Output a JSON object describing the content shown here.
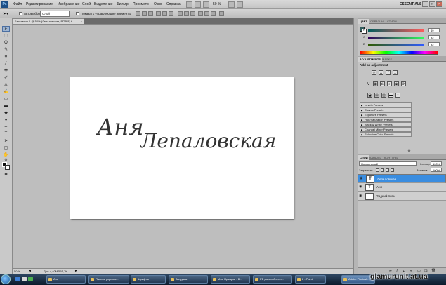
{
  "menubar": {
    "app_logo": "Ps",
    "items": [
      "Файл",
      "Редактирование",
      "Изображение",
      "Слой",
      "Выделение",
      "Фильтр",
      "Просмотр",
      "Окно",
      "Справка"
    ],
    "zoom": "50 %",
    "workspace": "ESSENTIALS ▾"
  },
  "options": {
    "autoselect_label": "Автовыбор:",
    "autoselect_value": "Слой",
    "show_controls_label": "Показать управляющие элементы"
  },
  "document": {
    "tab_title": "Безымянн-1 @ 50% (Лепаловская, RGB/8) *",
    "tab_close": "×",
    "canvas_text_1": "Аня",
    "canvas_text_2": "Лепаловская"
  },
  "statusbar": {
    "zoom": "50 %",
    "doc_info": "Док: 4,40М/555,7К"
  },
  "color_panel": {
    "tabs": [
      "ЦВЕТ",
      "ОБРАЗЦЫ",
      "СТИЛИ"
    ],
    "channels": [
      {
        "label": "R",
        "value": "49"
      },
      {
        "label": "G",
        "value": "92"
      },
      {
        "label": "B",
        "value": "92"
      }
    ]
  },
  "adjustments_panel": {
    "tabs": [
      "ADJUSTMENTS",
      "MASKS"
    ],
    "title": "Add an adjustment",
    "presets": [
      "Levels Presets",
      "Curves Presets",
      "Exposure Presets",
      "Hue/Saturation Presets",
      "Black & White Presets",
      "Channel Mixer Presets",
      "Selective Color Presets"
    ]
  },
  "layers_panel": {
    "tabs": [
      "СЛОИ",
      "КАНАЛЫ",
      "КОНТУРЫ"
    ],
    "blend_mode": "Нормальный",
    "opacity_label": "Непрозр.:",
    "opacity_value": "100%",
    "lock_label": "Закрепить:",
    "fill_label": "Заливка:",
    "fill_value": "100%",
    "layers": [
      {
        "name": "Лепаловская",
        "type": "T",
        "selected": true
      },
      {
        "name": "Аня",
        "type": "T",
        "selected": false
      },
      {
        "name": "Задний план",
        "type": "",
        "selected": false
      }
    ]
  },
  "taskbar": {
    "buttons": [
      "Аня",
      "Панель управле...",
      "Шрифты",
      "Загрузка",
      "Мои Ярмарки - Б...",
      "РЕ расслаблени...",
      "2 - Paint",
      "Adobe Photosh..."
    ],
    "watermark": "glamurunit.at.ua"
  },
  "colors": {
    "selection_blue": "#3a8de0",
    "annotation_red": "#e01010"
  }
}
